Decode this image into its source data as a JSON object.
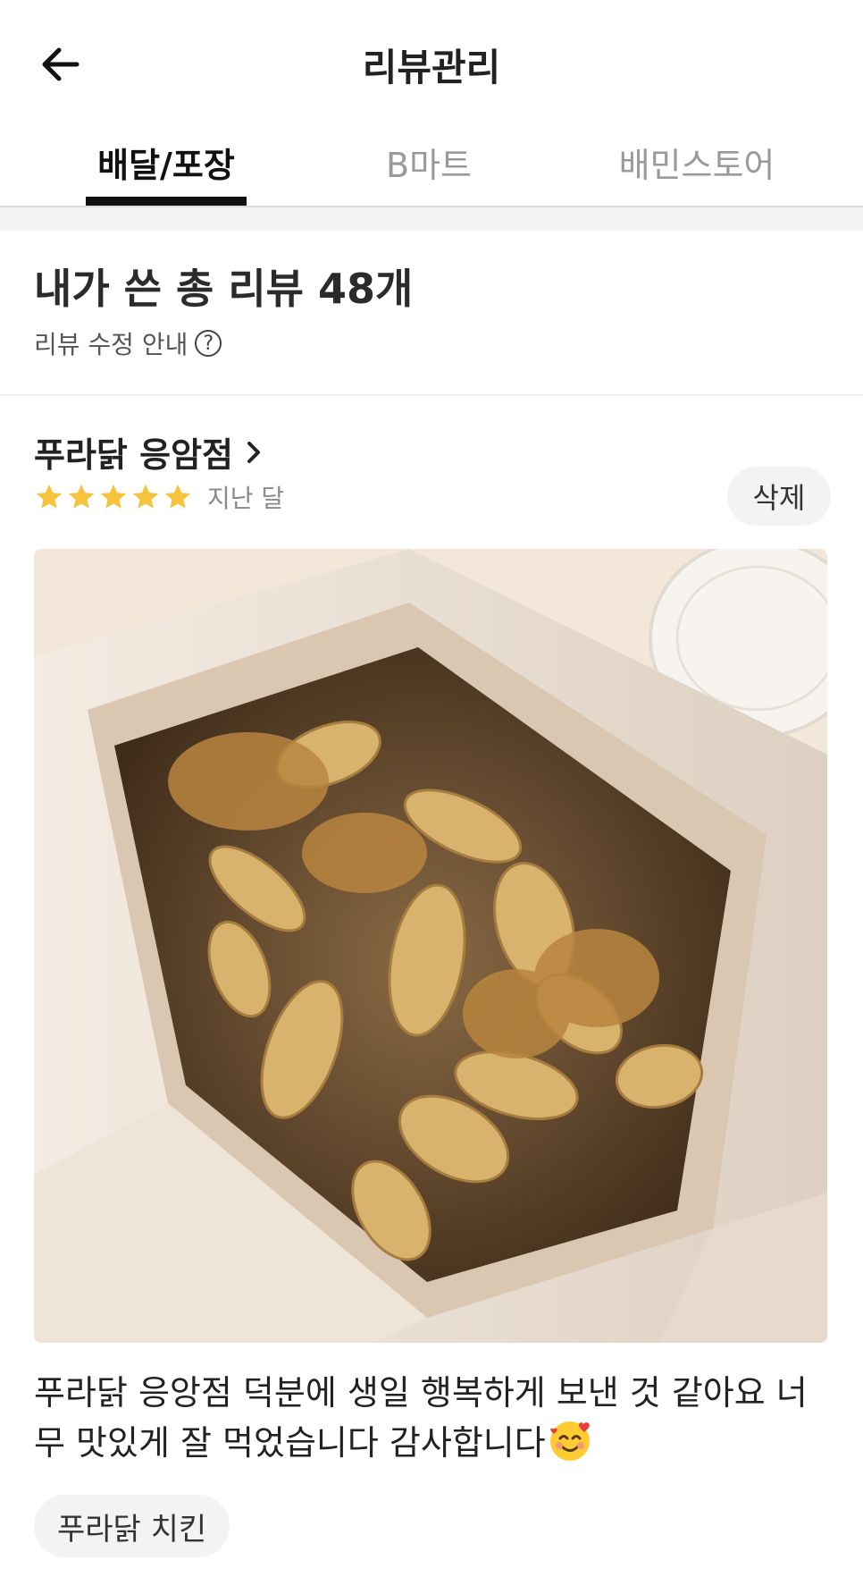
{
  "header": {
    "title": "리뷰관리",
    "back_icon": "arrow-left-icon"
  },
  "tabs": [
    {
      "label": "배달/포장",
      "active": true
    },
    {
      "label": "B마트",
      "active": false
    },
    {
      "label": "배민스토어",
      "active": false
    }
  ],
  "summary": {
    "title": "내가 쓴 총 리뷰 48개",
    "edit_guide": "리뷰 수정 안내",
    "help_icon": "question-circle-icon"
  },
  "review": {
    "store_name": "푸라닭 응암점",
    "rating": 5,
    "rating_max": 5,
    "date": "지난 달",
    "delete_label": "삭제",
    "photo": "fried chicken and potato wedges in a takeout box",
    "text": "푸라닭 응앙점 덕분에 생일 행복하게 보낸 것 같아요 너무 맛있게 잘 먹었습니다 감사합니다",
    "emoji": "smiling-face-with-hearts-icon",
    "tag": "푸라닭 치킨"
  },
  "colors": {
    "star": "#f7c33d",
    "active_tab": "#111111",
    "inactive_tab": "#9a9a9a",
    "pill_bg": "#f3f3f3"
  }
}
